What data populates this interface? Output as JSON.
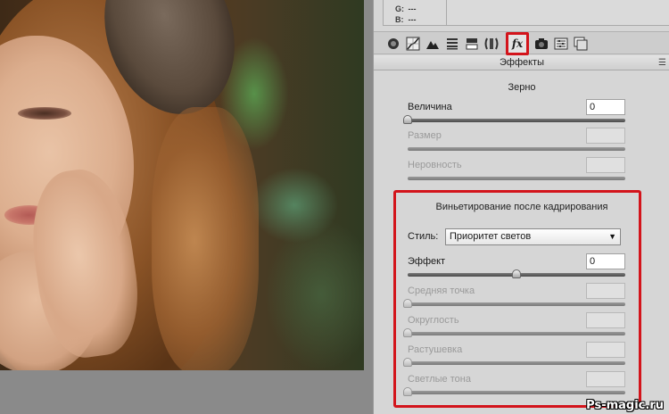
{
  "readout": {
    "rows": [
      {
        "label": "G:",
        "value": "---"
      },
      {
        "label": "B:",
        "value": "---"
      }
    ]
  },
  "toolbar": {
    "tools": [
      {
        "name": "basic-icon"
      },
      {
        "name": "tone-curve-icon"
      },
      {
        "name": "detail-icon"
      },
      {
        "name": "hsl-icon"
      },
      {
        "name": "split-toning-icon"
      },
      {
        "name": "lens-corrections-icon"
      },
      {
        "name": "effects-icon",
        "label": "fx",
        "active": true
      },
      {
        "name": "camera-calibration-icon"
      },
      {
        "name": "presets-icon"
      },
      {
        "name": "snapshots-icon"
      }
    ]
  },
  "panel": {
    "title": "Эффекты",
    "menu_icon": "panel-menu-icon"
  },
  "grain": {
    "title": "Зерно",
    "sliders": [
      {
        "label": "Величина",
        "value": "0",
        "level": 0,
        "enabled": true
      },
      {
        "label": "Размер",
        "value": "",
        "level": 0,
        "enabled": false
      },
      {
        "label": "Неровность",
        "value": "",
        "level": 0,
        "enabled": false
      }
    ]
  },
  "vignette": {
    "title": "Виньетирование после кадрирования",
    "style_label": "Стиль:",
    "style_value": "Приоритет светов",
    "sliders": [
      {
        "label": "Эффект",
        "value": "0",
        "level": 0.5,
        "enabled": true
      },
      {
        "label": "Средняя точка",
        "value": "",
        "level": 0,
        "enabled": false
      },
      {
        "label": "Округлость",
        "value": "",
        "level": 0,
        "enabled": false
      },
      {
        "label": "Растушевка",
        "value": "",
        "level": 0,
        "enabled": false
      },
      {
        "label": "Светлые тона",
        "value": "",
        "level": 0,
        "enabled": false
      }
    ]
  },
  "watermark": "Ps-magic.ru",
  "colors": {
    "highlight": "#d3141b",
    "panel_bg": "#d6d6d6"
  }
}
